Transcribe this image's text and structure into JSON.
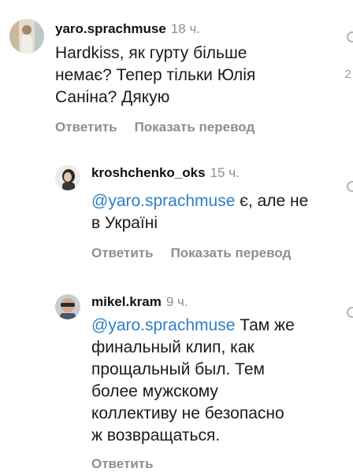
{
  "comments": [
    {
      "username": "yaro.sprachmuse",
      "time": "18 ч.",
      "lines": [
        "Hardkiss, як гурту більше",
        "немає? Тепер тільки Юлія",
        "Саніна? Дякую"
      ],
      "reply_label": "Ответить",
      "translate_label": "Показать перевод",
      "edge_count": "2"
    },
    {
      "username": "kroshchenko_oks",
      "time": "15 ч.",
      "mention": "@yaro.sprachmuse",
      "line1_rest": " є, але не",
      "line2": "в Україні",
      "reply_label": "Ответить",
      "translate_label": "Показать перевод"
    },
    {
      "username": "mikel.kram",
      "time": "9 ч.",
      "mention": "@yaro.sprachmuse",
      "line1_rest": " Там же",
      "lines_rest": [
        "финальный клип, как",
        "прощальный был. Тем",
        "более мужскому",
        "коллективу не безопасно",
        "ж возвращаться."
      ],
      "reply_label": "Ответить"
    }
  ],
  "colors": {
    "mention": "#2f7fc8",
    "muted": "#8e8e8e"
  }
}
